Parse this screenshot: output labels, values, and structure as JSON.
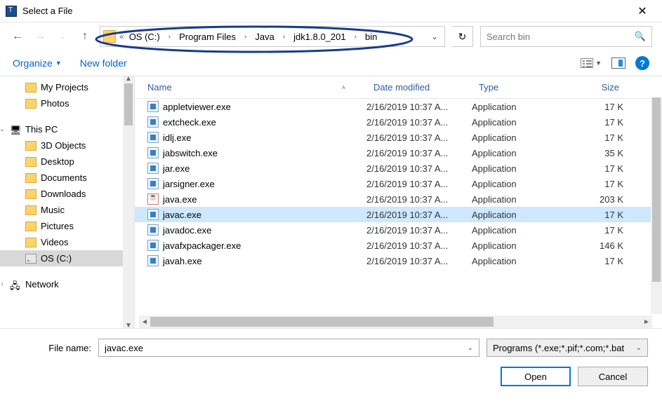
{
  "window": {
    "title": "Select a File"
  },
  "nav": {
    "refresh_glyph": "↻"
  },
  "breadcrumb": {
    "prefix": "«",
    "items": [
      "OS (C:)",
      "Program Files",
      "Java",
      "jdk1.8.0_201",
      "bin"
    ]
  },
  "search": {
    "placeholder": "Search bin"
  },
  "toolbar": {
    "organize": "Organize",
    "newfolder": "New folder"
  },
  "sidebar": {
    "quick": [
      {
        "label": "My Projects",
        "icon": "folder"
      },
      {
        "label": "Photos",
        "icon": "folder"
      }
    ],
    "thispc_label": "This PC",
    "thispc": [
      {
        "label": "3D Objects",
        "icon": "folder"
      },
      {
        "label": "Desktop",
        "icon": "folder"
      },
      {
        "label": "Documents",
        "icon": "folder"
      },
      {
        "label": "Downloads",
        "icon": "folder"
      },
      {
        "label": "Music",
        "icon": "folder"
      },
      {
        "label": "Pictures",
        "icon": "folder"
      },
      {
        "label": "Videos",
        "icon": "folder"
      },
      {
        "label": "OS (C:)",
        "icon": "drive",
        "highlight": true
      }
    ],
    "network_label": "Network"
  },
  "columns": {
    "name": "Name",
    "date": "Date modified",
    "type": "Type",
    "size": "Size"
  },
  "files": [
    {
      "name": "appletviewer.exe",
      "date": "2/16/2019 10:37 A...",
      "type": "Application",
      "size": "17 K",
      "icon": "exe"
    },
    {
      "name": "extcheck.exe",
      "date": "2/16/2019 10:37 A...",
      "type": "Application",
      "size": "17 K",
      "icon": "exe"
    },
    {
      "name": "idlj.exe",
      "date": "2/16/2019 10:37 A...",
      "type": "Application",
      "size": "17 K",
      "icon": "exe"
    },
    {
      "name": "jabswitch.exe",
      "date": "2/16/2019 10:37 A...",
      "type": "Application",
      "size": "35 K",
      "icon": "exe"
    },
    {
      "name": "jar.exe",
      "date": "2/16/2019 10:37 A...",
      "type": "Application",
      "size": "17 K",
      "icon": "exe"
    },
    {
      "name": "jarsigner.exe",
      "date": "2/16/2019 10:37 A...",
      "type": "Application",
      "size": "17 K",
      "icon": "exe"
    },
    {
      "name": "java.exe",
      "date": "2/16/2019 10:37 A...",
      "type": "Application",
      "size": "203 K",
      "icon": "java"
    },
    {
      "name": "javac.exe",
      "date": "2/16/2019 10:37 A...",
      "type": "Application",
      "size": "17 K",
      "icon": "exe",
      "selected": true
    },
    {
      "name": "javadoc.exe",
      "date": "2/16/2019 10:37 A...",
      "type": "Application",
      "size": "17 K",
      "icon": "exe"
    },
    {
      "name": "javafxpackager.exe",
      "date": "2/16/2019 10:37 A...",
      "type": "Application",
      "size": "146 K",
      "icon": "exe"
    },
    {
      "name": "javah.exe",
      "date": "2/16/2019 10:37 A...",
      "type": "Application",
      "size": "17 K",
      "icon": "exe"
    }
  ],
  "filename": {
    "label": "File name:",
    "value": "javac.exe"
  },
  "filter": {
    "label": "Programs (*.exe;*.pif;*.com;*.bat"
  },
  "buttons": {
    "open": "Open",
    "cancel": "Cancel"
  }
}
